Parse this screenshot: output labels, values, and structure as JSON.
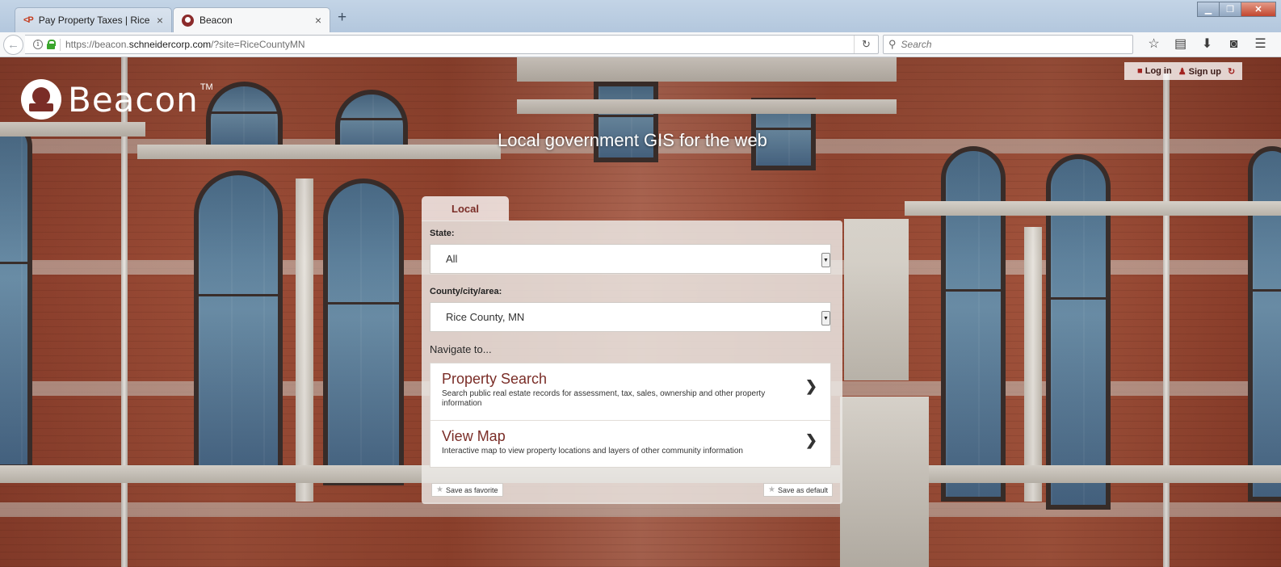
{
  "browser": {
    "tabs": [
      {
        "title": "Pay Property Taxes | Rice C...",
        "favicon": "pay-icon",
        "active": false
      },
      {
        "title": "Beacon",
        "favicon": "beacon-icon",
        "active": true
      }
    ],
    "new_tab": "+",
    "url_prefix": "https://beacon.",
    "url_domain": "schneidercorp.com",
    "url_suffix": "/?site=RiceCountyMN",
    "search_placeholder": "Search"
  },
  "site": {
    "logo_text": "Beacon",
    "logo_tm": "TM",
    "login_label": "Log in",
    "signup_label": "Sign up",
    "tagline": "Local government GIS for the web",
    "brand_color": "#7a2d27"
  },
  "search": {
    "tab_label": "Local",
    "state_label": "State:",
    "state_value": "All",
    "county_label": "County/city/area:",
    "county_value": "Rice County, MN",
    "navigate_label": "Navigate to...",
    "items": [
      {
        "title": "Property Search",
        "desc": "Search public real estate records for assessment, tax, sales, ownership and other property information"
      },
      {
        "title": "View Map",
        "desc": "Interactive map to view property locations and layers of other community information"
      }
    ],
    "save_favorite": "Save as favorite",
    "save_default": "Save as default"
  }
}
